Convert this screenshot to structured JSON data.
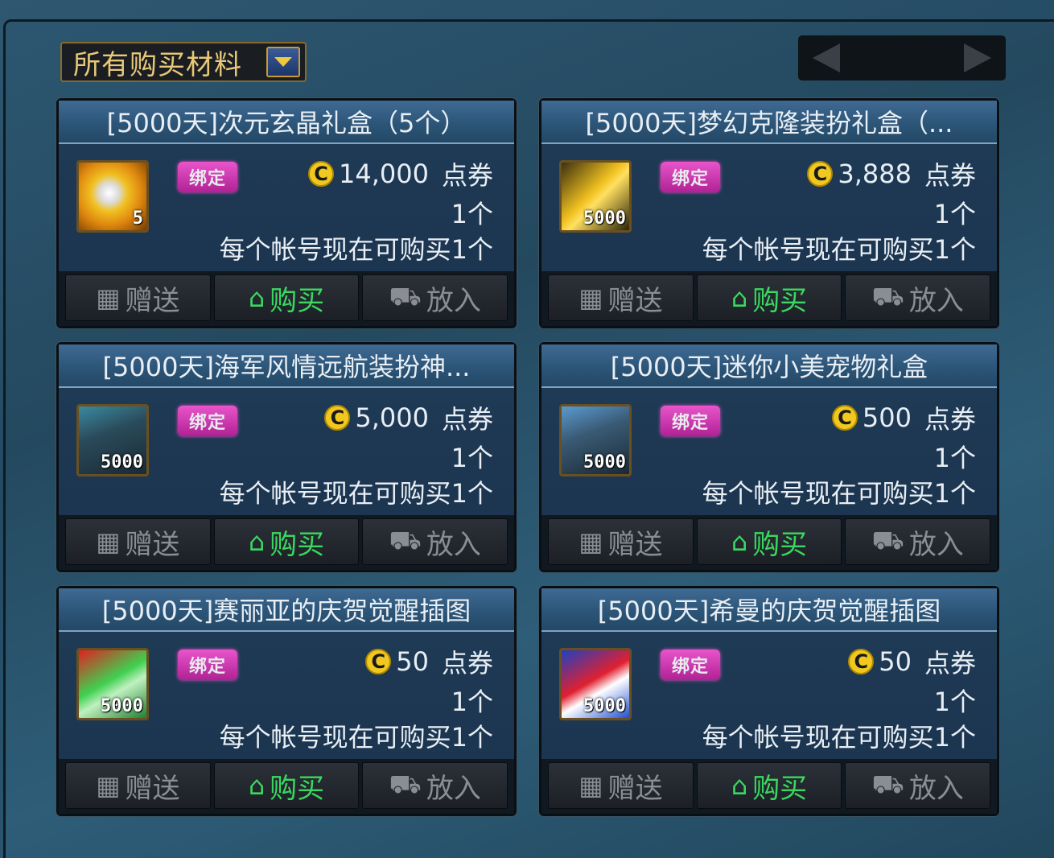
{
  "category_select": {
    "label": "所有购买材料",
    "icon": "chevron-down-icon"
  },
  "pager": {
    "prev_icon": "arrow-left-icon",
    "next_icon": "arrow-right-icon"
  },
  "colors": {
    "title_text": "#e8eef4",
    "buy_button": "#3ad860",
    "bind_badge": "#ff58d8",
    "coin": "#f0c820"
  },
  "items": [
    {
      "title": "[5000天]次元玄晶礼盒（5个）",
      "icon_text": "5",
      "icon": "crystal-gift-box-icon",
      "bind_badge": "绑定",
      "price": "14,000",
      "currency": "点券",
      "quantity": "1个",
      "limit": "每个帐号现在可购买1个"
    },
    {
      "title": "[5000天]梦幻克隆装扮礼盒（...",
      "icon_text": "5000",
      "icon": "clone-costume-box-icon",
      "bind_badge": "绑定",
      "price": "3,888",
      "currency": "点券",
      "quantity": "1个",
      "limit": "每个帐号现在可购买1个"
    },
    {
      "title": "[5000天]海军风情远航装扮神...",
      "icon_text": "5000",
      "icon": "chest-icon",
      "bind_badge": "绑定",
      "price": "5,000",
      "currency": "点券",
      "quantity": "1个",
      "limit": "每个帐号现在可购买1个"
    },
    {
      "title": "[5000天]迷你小美宠物礼盒",
      "icon_text": "5000",
      "icon": "pet-chest-icon",
      "bind_badge": "绑定",
      "price": "500",
      "currency": "点券",
      "quantity": "1个",
      "limit": "每个帐号现在可购买1个"
    },
    {
      "title": "[5000天]赛丽亚的庆贺觉醒插图",
      "icon_text": "5000",
      "icon": "illustration-icon",
      "bind_badge": "绑定",
      "price": "50",
      "currency": "点券",
      "quantity": "1个",
      "limit": "每个帐号现在可购买1个"
    },
    {
      "title": "[5000天]希曼的庆贺觉醒插图",
      "icon_text": "5000",
      "icon": "illustration-icon",
      "bind_badge": "绑定",
      "price": "50",
      "currency": "点券",
      "quantity": "1个",
      "limit": "每个帐号现在可购买1个"
    }
  ],
  "actions": {
    "gift_label": "赠送",
    "buy_label": "购买",
    "cart_label": "放入"
  }
}
